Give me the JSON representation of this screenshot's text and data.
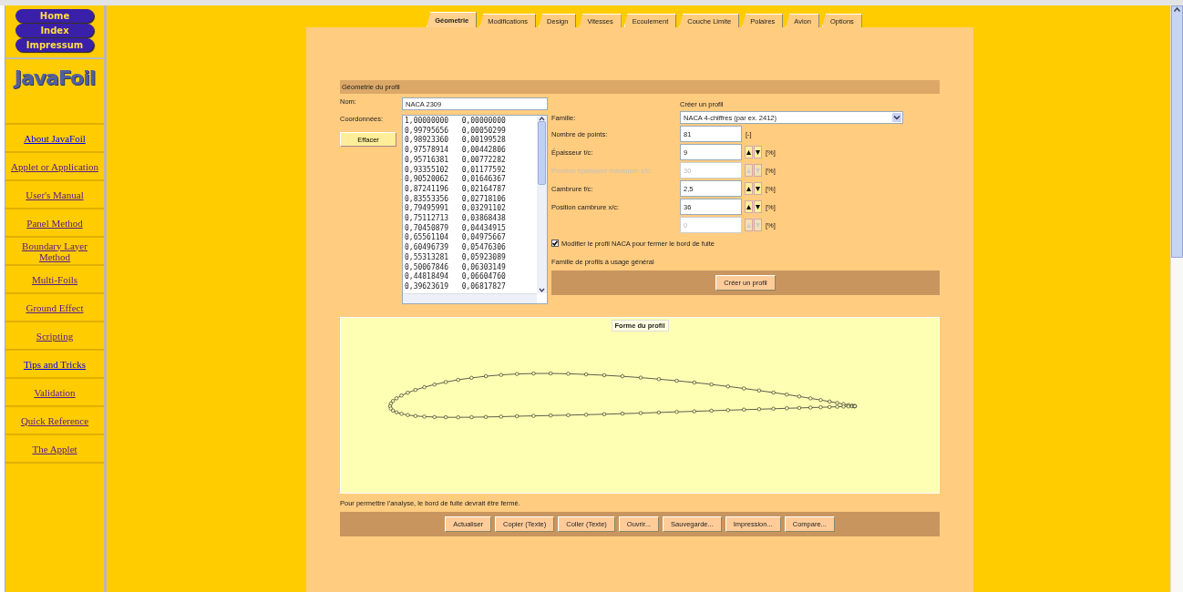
{
  "sidebar": {
    "nav_buttons": [
      "Home",
      "Index",
      "Impressum"
    ],
    "logo": "JavaFoil",
    "links": [
      {
        "label": "About JavaFoil",
        "visited": false
      },
      {
        "label": "Applet or Application",
        "visited": true
      },
      {
        "label": "User's Manual",
        "visited": true
      },
      {
        "label": "Panel Method",
        "visited": true
      },
      {
        "label": "Boundary Layer Method",
        "visited": true
      },
      {
        "label": "Multi-Foils",
        "visited": true
      },
      {
        "label": "Ground Effect",
        "visited": true
      },
      {
        "label": "Scripting",
        "visited": true
      },
      {
        "label": "Tips and Tricks",
        "visited": false
      },
      {
        "label": "Validation",
        "visited": true
      },
      {
        "label": "Quick Reference",
        "visited": true
      },
      {
        "label": "The Applet",
        "visited": true
      }
    ]
  },
  "tabs": [
    {
      "label": "Géometrie",
      "selected": true
    },
    {
      "label": "Modifications",
      "selected": false
    },
    {
      "label": "Design",
      "selected": false
    },
    {
      "label": "Vitesses",
      "selected": false
    },
    {
      "label": "Ecoulement",
      "selected": false
    },
    {
      "label": "Couche Limite",
      "selected": false
    },
    {
      "label": "Polaires",
      "selected": false
    },
    {
      "label": "Avion",
      "selected": false
    },
    {
      "label": "Options",
      "selected": false
    }
  ],
  "section_title": "Géometrie du profil",
  "name_field": {
    "label": "Nom:",
    "value": "NACA 2309"
  },
  "coordinates": {
    "label": "Coordonnées:",
    "rows": [
      [
        "1,00000000",
        "0,00000000"
      ],
      [
        "0,99795656",
        "0,00050299"
      ],
      [
        "0,98923360",
        "0,00199528"
      ],
      [
        "0,97578914",
        "0,00442806"
      ],
      [
        "0,95716381",
        "0,00772282"
      ],
      [
        "0,93355102",
        "0,01177592"
      ],
      [
        "0,90520062",
        "0,01646367"
      ],
      [
        "0,87241196",
        "0,02164787"
      ],
      [
        "0,83553356",
        "0,02718106"
      ],
      [
        "0,79495991",
        "0,03291102"
      ],
      [
        "0,75112713",
        "0,03868438"
      ],
      [
        "0,70450879",
        "0,04434915"
      ],
      [
        "0,65561104",
        "0,04975667"
      ],
      [
        "0,60496739",
        "0,05476306"
      ],
      [
        "0,55313281",
        "0,05923089"
      ],
      [
        "0,50067846",
        "0,06303149"
      ],
      [
        "0,44818494",
        "0,06604760"
      ],
      [
        "0,39623619",
        "0,06817827"
      ]
    ]
  },
  "clear_button": "Effacer",
  "generator": {
    "title": "Créer un profil",
    "family": {
      "label": "Famille:",
      "value": "NACA 4-chiffres (par ex. 2412)"
    },
    "params": [
      {
        "label": "Nombre de points:",
        "value": "81",
        "unit": "[-]",
        "disabled": false,
        "kind": "plain"
      },
      {
        "label": "Épaisseur t/c:",
        "value": "9",
        "unit": "[%]",
        "disabled": false,
        "kind": "spinner"
      },
      {
        "label": "Position épaisseur maximum x/c:",
        "value": "30",
        "unit": "[%]",
        "disabled": true,
        "kind": "spinner"
      },
      {
        "label": "Cambrure f/c:",
        "value": "2,5",
        "unit": "[%]",
        "disabled": false,
        "kind": "spinner"
      },
      {
        "label": "Position cambrure x/c:",
        "value": "36",
        "unit": "[%]",
        "disabled": false,
        "kind": "spinner"
      },
      {
        "value": "0",
        "unit": "[%]",
        "disabled": true,
        "kind": "spinner"
      }
    ],
    "checkbox": {
      "label": "Modifier le profil NACA pour fermer le bord de fuite",
      "checked": true
    },
    "description": "Famille de profils à usage général",
    "button": "Créer un profil"
  },
  "plot": {
    "title": "Forme du profil"
  },
  "message": "Pour permettre l'analyse, le bord de fuite devrait être fermé.",
  "buttons": [
    "Actualiser",
    "Copier (Texte)",
    "Coller (Texte)",
    "Ouvrir...",
    "Sauvegarde...",
    "Impression...",
    "Compare..."
  ]
}
